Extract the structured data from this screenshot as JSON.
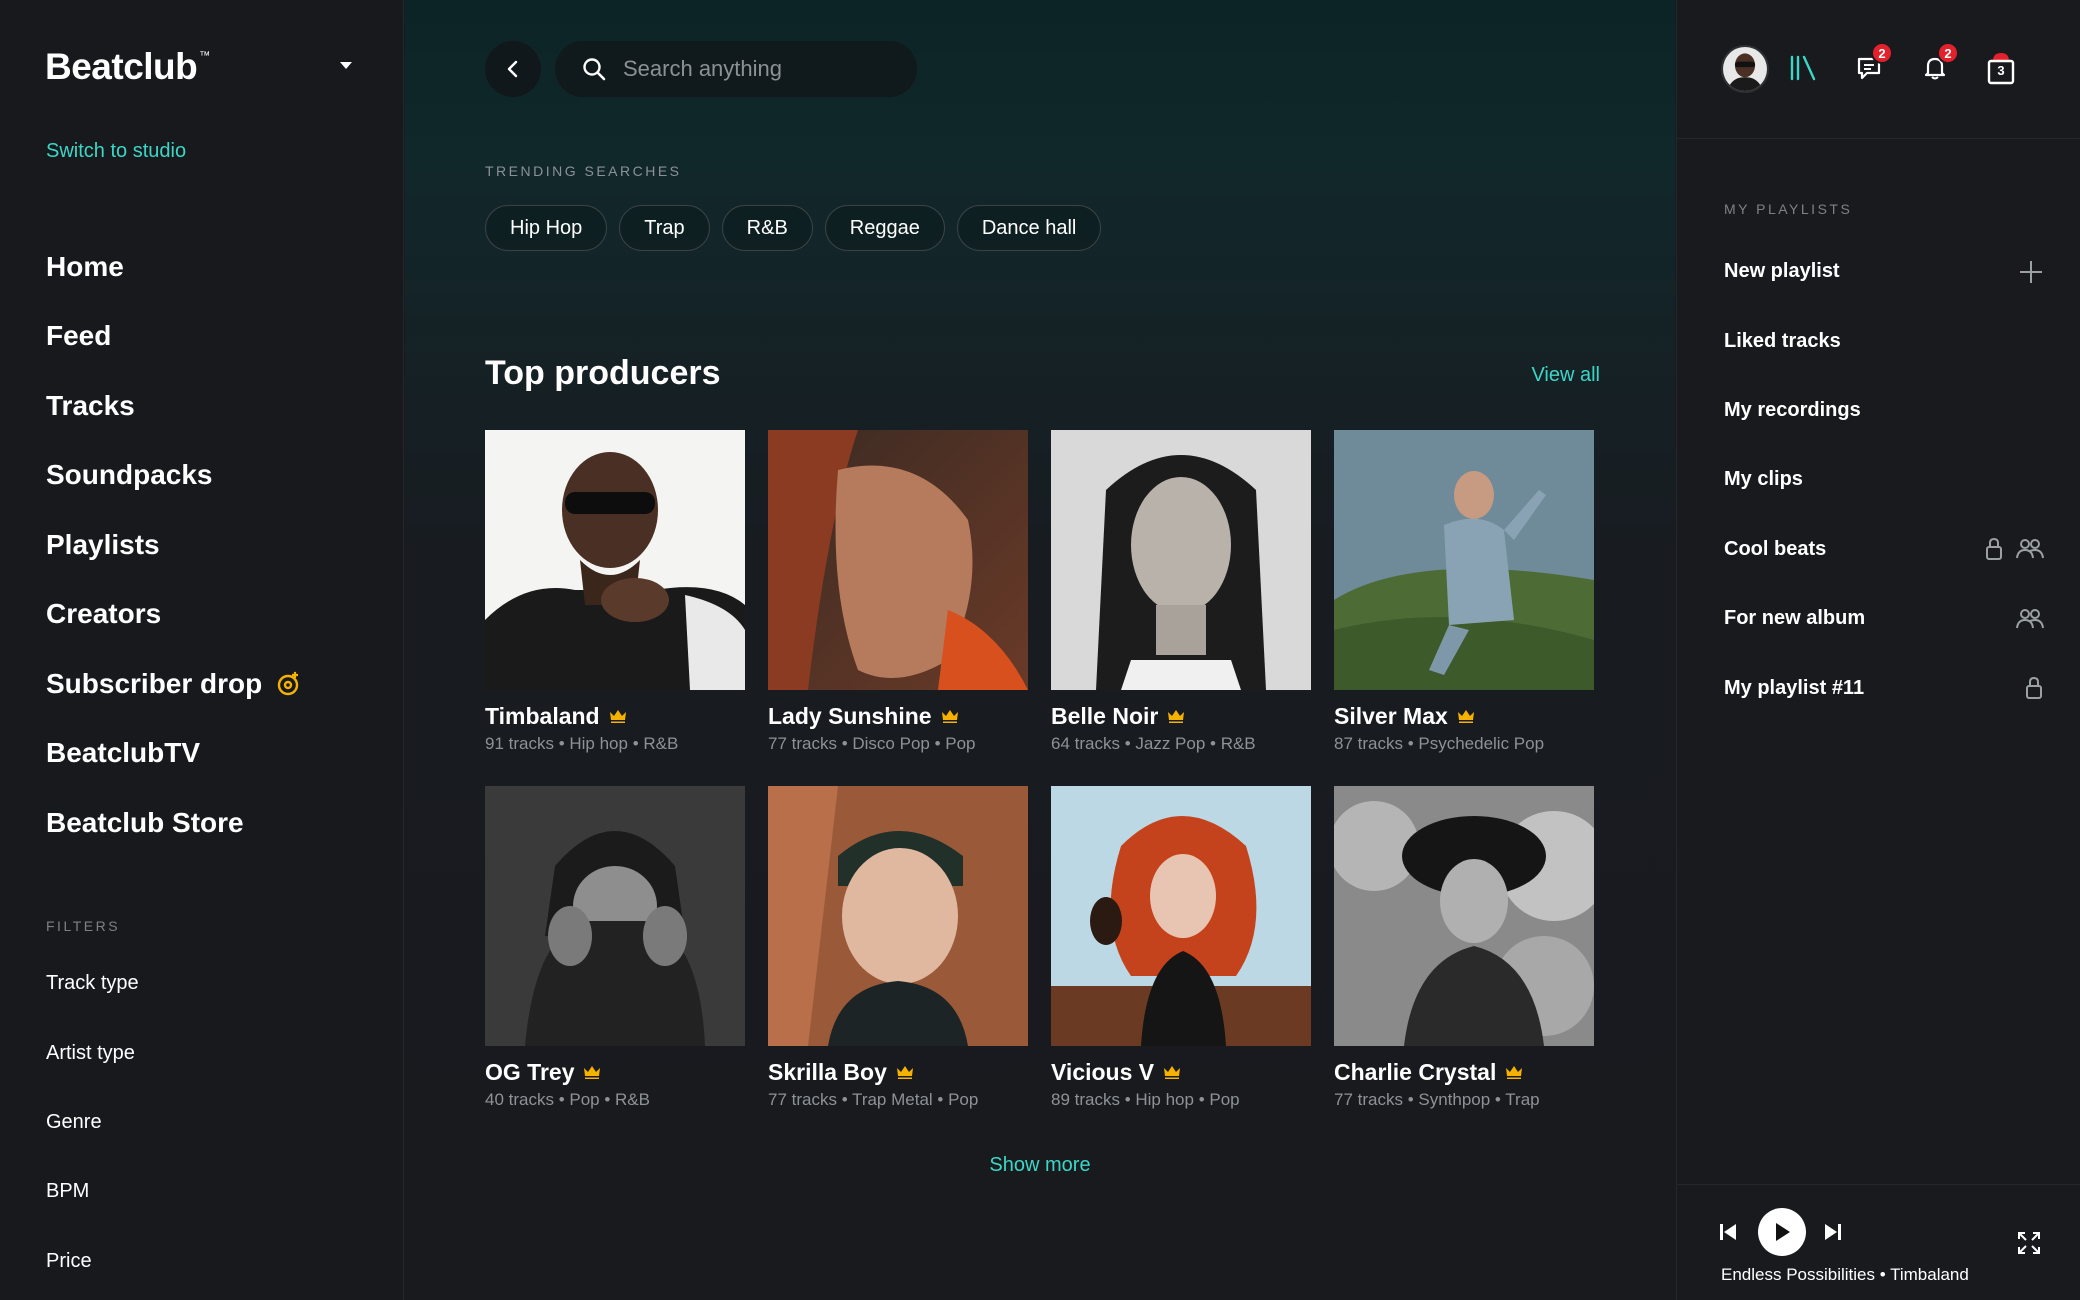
{
  "brand": {
    "name": "Beatclub",
    "tm": "™"
  },
  "sidebar": {
    "switch_label": "Switch to studio",
    "nav": [
      {
        "label": "Home"
      },
      {
        "label": "Feed"
      },
      {
        "label": "Tracks"
      },
      {
        "label": "Soundpacks"
      },
      {
        "label": "Playlists"
      },
      {
        "label": "Creators"
      },
      {
        "label": "Subscriber drop",
        "icon": "subscriber-drop-icon"
      },
      {
        "label": "BeatclubTV"
      },
      {
        "label": "Beatclub Store"
      }
    ],
    "filters_label": "FILTERS",
    "filters": [
      {
        "label": "Track type"
      },
      {
        "label": "Artist type"
      },
      {
        "label": "Genre"
      },
      {
        "label": "BPM"
      },
      {
        "label": "Price"
      }
    ]
  },
  "search": {
    "placeholder": "Search anything",
    "value": ""
  },
  "trending": {
    "label": "TRENDING SEARCHES",
    "chips": [
      "Hip Hop",
      "Trap",
      "R&B",
      "Reggae",
      "Dance hall"
    ]
  },
  "producers": {
    "title": "Top producers",
    "view_all": "View all",
    "show_more": "Show more",
    "items": [
      {
        "name": "Timbaland",
        "meta": "91 tracks • Hip hop • R&B"
      },
      {
        "name": "Lady Sunshine",
        "meta": "77 tracks • Disco Pop • Pop"
      },
      {
        "name": "Belle Noir",
        "meta": "64 tracks • Jazz Pop • R&B"
      },
      {
        "name": "Silver Max",
        "meta": "87 tracks • Psychedelic Pop"
      },
      {
        "name": "OG Trey",
        "meta": "40 tracks • Pop • R&B"
      },
      {
        "name": "Skrilla Boy",
        "meta": "77 tracks • Trap Metal • Pop"
      },
      {
        "name": "Vicious V",
        "meta": "89 tracks • Hip hop • Pop"
      },
      {
        "name": "Charlie Crystal",
        "meta": "77 tracks • Synthpop • Trap"
      }
    ]
  },
  "topbar": {
    "messages_count": "2",
    "notifications_count": "2",
    "cart_count": "3"
  },
  "playlists": {
    "label": "MY PLAYLISTS",
    "items": [
      {
        "label": "New playlist",
        "icons": [
          "plus-icon"
        ]
      },
      {
        "label": "Liked tracks",
        "icons": []
      },
      {
        "label": "My recordings",
        "icons": []
      },
      {
        "label": "My clips",
        "icons": []
      },
      {
        "label": "Cool beats",
        "icons": [
          "lock-icon",
          "collaborators-icon"
        ]
      },
      {
        "label": "For new album",
        "icons": [
          "collaborators-icon"
        ]
      },
      {
        "label": "My playlist #11",
        "icons": [
          "lock-icon"
        ]
      }
    ]
  },
  "player": {
    "now_playing": "Endless Possibilities • Timbaland"
  },
  "colors": {
    "accent": "#3cd6c6",
    "crown": "#f5b200",
    "badge": "#e3212c",
    "background": "#181a1e"
  }
}
